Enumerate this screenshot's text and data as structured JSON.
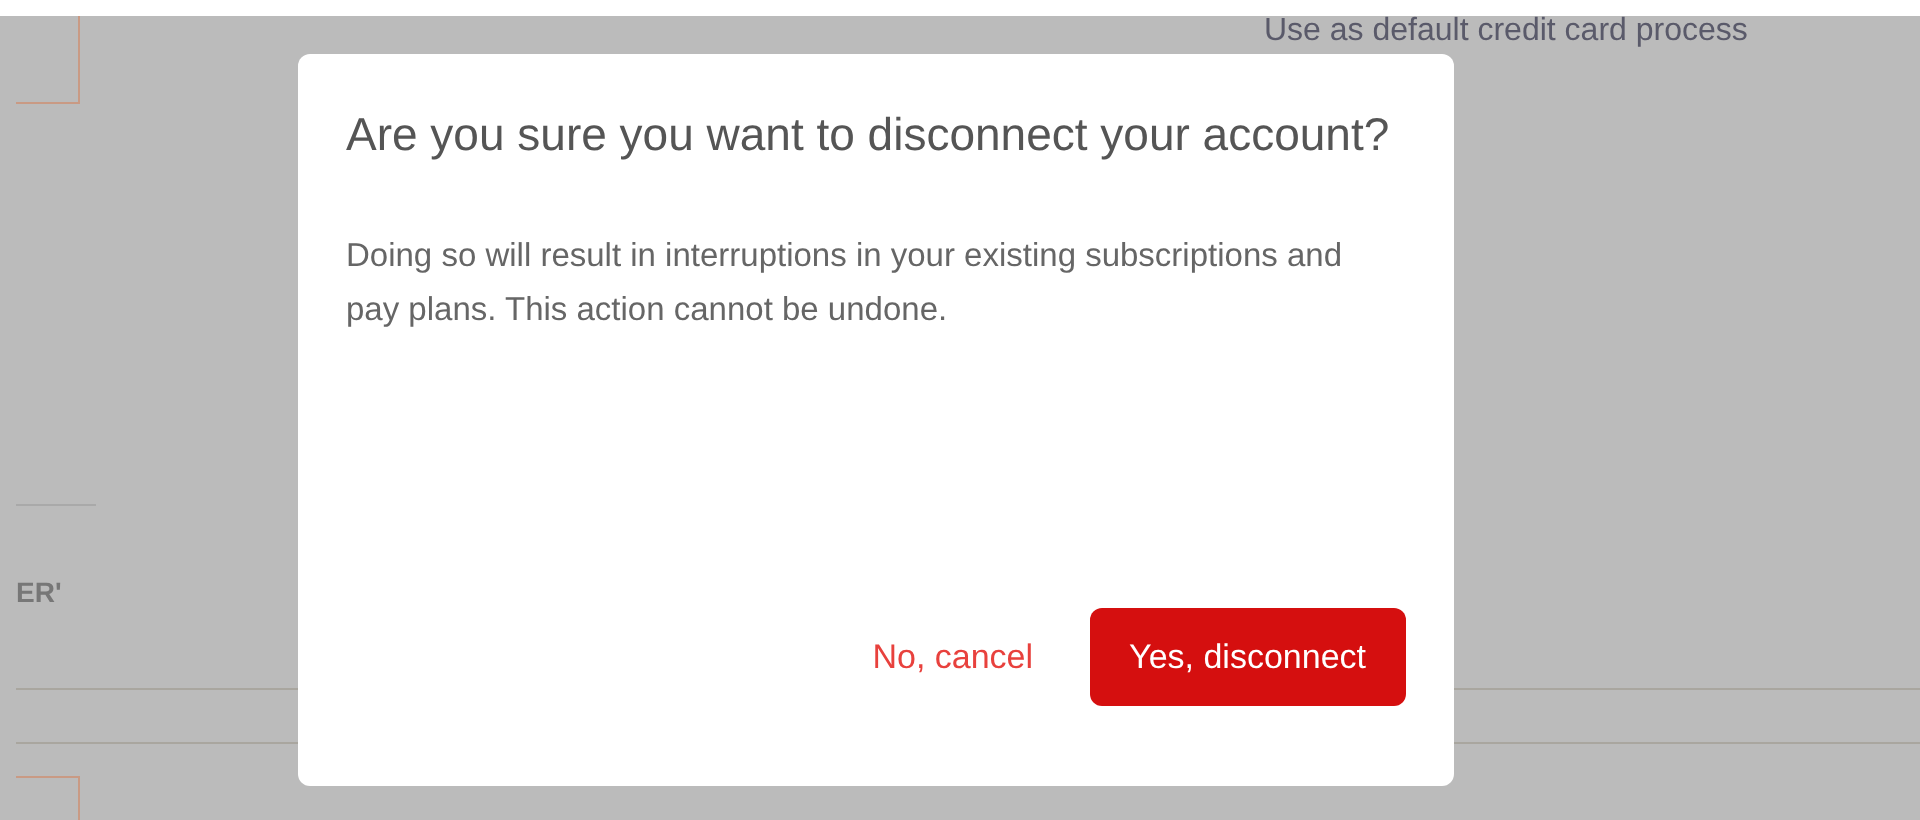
{
  "background": {
    "checkbox_label": "Use as default credit card process",
    "side_label": "ER'"
  },
  "dialog": {
    "title": "Are you sure you want to disconnect your account?",
    "message": "Doing so will result in interruptions in your existing subscriptions and pay plans. This action cannot be undone.",
    "buttons": [
      {
        "label": "No, cancel",
        "kind": "secondary"
      },
      {
        "label": "Yes, disconnect",
        "kind": "primary"
      }
    ]
  }
}
